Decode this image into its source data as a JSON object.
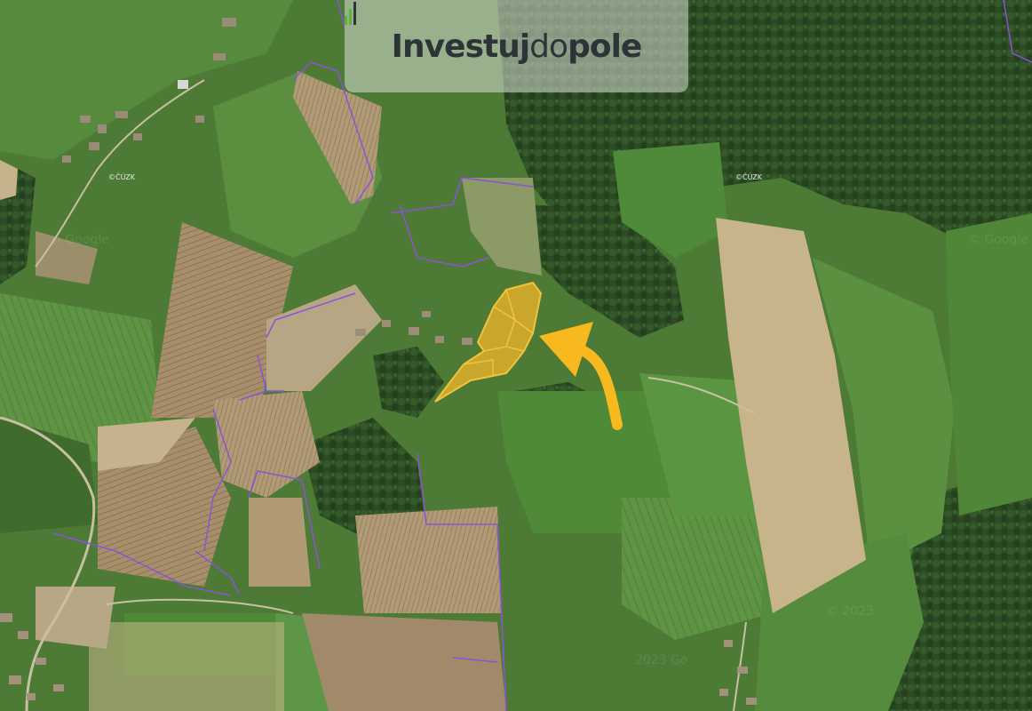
{
  "brand": {
    "logo_text_bold_1": "Investuj",
    "logo_text_light": "do",
    "logo_text_bold_2": "pole",
    "accent": "#5fb33a",
    "text_color": "#2d3438"
  },
  "watermarks": {
    "cuzk_1": "©ČÚZK",
    "cuzk_2": "©ČÚZK",
    "google_1": "© Google",
    "google_2": "© Google",
    "year_1": "© 2023",
    "year_2": "2023 Go"
  },
  "village_label": "",
  "colors": {
    "plot_fill": "#f3b52a",
    "plot_stroke": "#f5c23b",
    "arrow": "#f7b91e",
    "cadastre_line": "#8a52d9"
  },
  "plot": {
    "description_visible": false
  }
}
